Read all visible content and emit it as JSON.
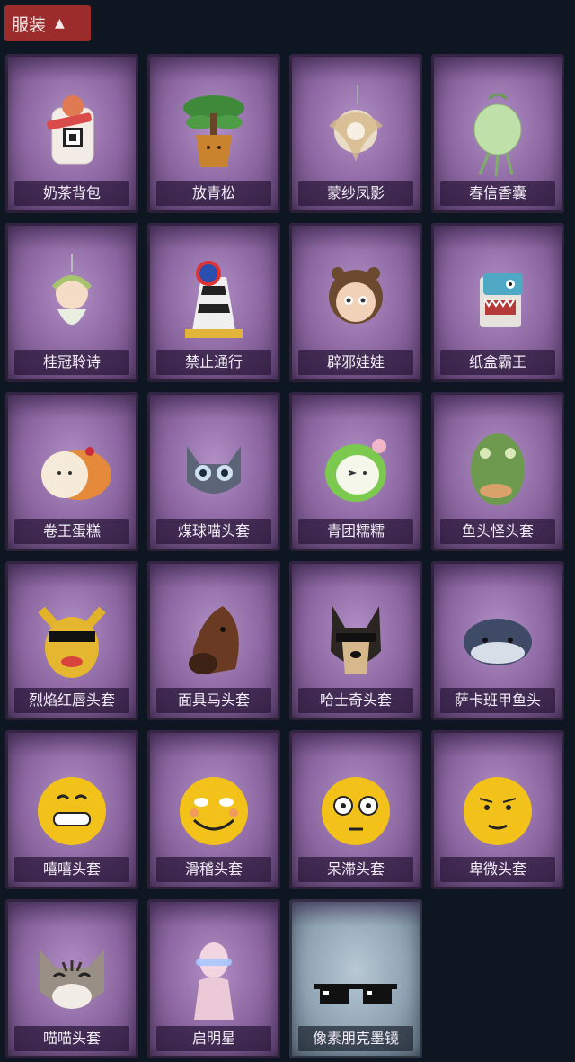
{
  "header": {
    "title": "服装",
    "chevron_icon": "chevron-up-icon"
  },
  "items": [
    {
      "name": "奶茶背包",
      "icon": "milk-tea-backpack-icon"
    },
    {
      "name": "放青松",
      "icon": "potted-pine-icon"
    },
    {
      "name": "蒙纱凤影",
      "icon": "phoenix-charm-icon"
    },
    {
      "name": "春信香囊",
      "icon": "sachet-icon"
    },
    {
      "name": "桂冠聆诗",
      "icon": "laurel-doll-charm-icon"
    },
    {
      "name": "禁止通行",
      "icon": "no-entry-cone-icon"
    },
    {
      "name": "辟邪娃娃",
      "icon": "doll-head-icon"
    },
    {
      "name": "纸盒霸王",
      "icon": "cardboard-dino-icon"
    },
    {
      "name": "卷王蛋糕",
      "icon": "roll-cake-icon"
    },
    {
      "name": "煤球喵头套",
      "icon": "gray-cat-head-icon"
    },
    {
      "name": "青团糯糯",
      "icon": "green-rice-ball-icon"
    },
    {
      "name": "鱼头怪头套",
      "icon": "fish-head-mask-icon"
    },
    {
      "name": "烈焰红唇头套",
      "icon": "yellow-mask-sunglasses-icon"
    },
    {
      "name": "面具马头套",
      "icon": "horse-mask-icon"
    },
    {
      "name": "哈士奇头套",
      "icon": "husky-mask-icon"
    },
    {
      "name": "萨卡班甲鱼头",
      "icon": "sacabambaspis-head-icon"
    },
    {
      "name": "嘻嘻头套",
      "icon": "grin-emoji-icon"
    },
    {
      "name": "滑稽头套",
      "icon": "funny-emoji-icon"
    },
    {
      "name": "呆滞头套",
      "icon": "stare-emoji-icon"
    },
    {
      "name": "卑微头套",
      "icon": "meek-emoji-icon"
    },
    {
      "name": "喵喵头套",
      "icon": "tabby-cat-head-icon"
    },
    {
      "name": "启明星",
      "icon": "glowing-figure-icon"
    },
    {
      "name": "像素朋克墨镜",
      "icon": "pixel-sunglasses-icon",
      "rarity": "grey"
    }
  ]
}
